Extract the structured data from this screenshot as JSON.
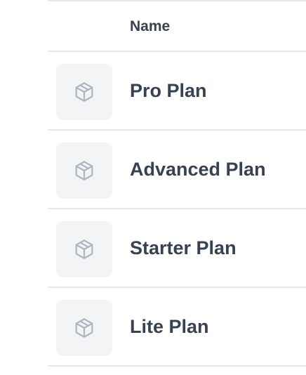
{
  "table": {
    "columns": [
      "Name"
    ],
    "rows": [
      {
        "name": "Pro Plan",
        "icon": "package-icon"
      },
      {
        "name": "Advanced Plan",
        "icon": "package-icon"
      },
      {
        "name": "Starter Plan",
        "icon": "package-icon"
      },
      {
        "name": "Lite Plan",
        "icon": "package-icon"
      }
    ]
  },
  "colors": {
    "text": "#374151",
    "border": "#e5e7eb",
    "thumb_bg": "#f3f4f6",
    "icon": "#9ca3af"
  }
}
